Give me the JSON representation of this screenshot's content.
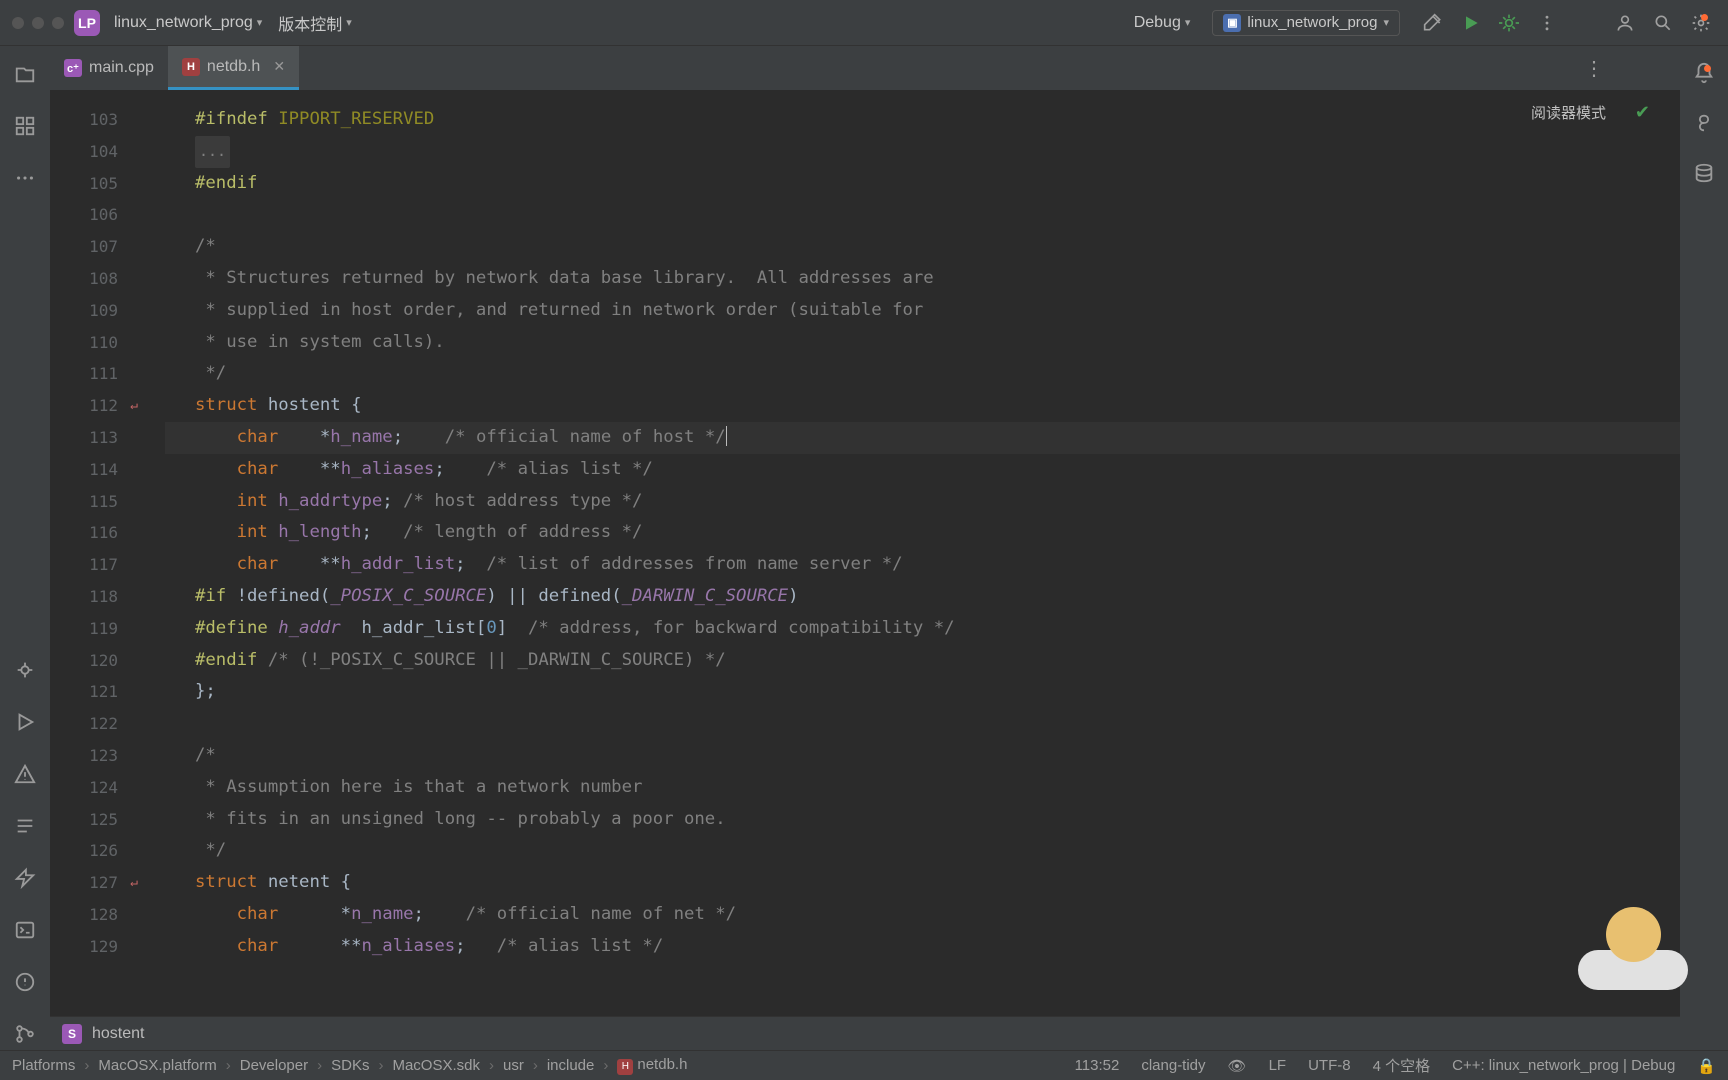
{
  "topbar": {
    "project_badge": "LP",
    "project_name": "linux_network_prog",
    "vcs_label": "版本控制",
    "build_config": "Debug",
    "run_config_name": "linux_network_prog"
  },
  "tabs": {
    "items": [
      {
        "icon_class": "ico-cpp",
        "icon_text": "c⁺",
        "label": "main.cpp",
        "closable": false,
        "active": false
      },
      {
        "icon_class": "ico-h",
        "icon_text": "H",
        "label": "netdb.h",
        "closable": true,
        "active": true
      }
    ],
    "reader_mode_label": "阅读器模式"
  },
  "struct_bar": {
    "icon_letter": "S",
    "name": "hostent"
  },
  "status": {
    "crumbs": [
      "Platforms",
      "MacOSX.platform",
      "Developer",
      "SDKs",
      "MacOSX.sdk",
      "usr",
      "include",
      "netdb.h"
    ],
    "pos": "113:52",
    "linter": "clang-tidy",
    "lf": "LF",
    "encoding": "UTF-8",
    "indent": "4 个空格",
    "context": "C++: linux_network_prog | Debug"
  },
  "gutter": {
    "start": 103,
    "count": 27,
    "arrow_rows": [
      112,
      127
    ]
  },
  "code": [
    {
      "n": 103,
      "tokens": [
        [
          "pp",
          "#ifndef "
        ],
        [
          "mac",
          "IPPORT_RESERVED"
        ]
      ]
    },
    {
      "n": 104,
      "fold": "..."
    },
    {
      "n": 105,
      "tokens": [
        [
          "pp",
          "#endif"
        ]
      ]
    },
    {
      "n": 106,
      "tokens": []
    },
    {
      "n": 107,
      "tokens": [
        [
          "cmt",
          "/*"
        ]
      ]
    },
    {
      "n": 108,
      "tokens": [
        [
          "cmt",
          " * Structures returned by network data base library.  All addresses are"
        ]
      ]
    },
    {
      "n": 109,
      "tokens": [
        [
          "cmt",
          " * supplied in host order, and returned in network order (suitable for"
        ]
      ]
    },
    {
      "n": 110,
      "tokens": [
        [
          "cmt",
          " * use in system calls)."
        ]
      ]
    },
    {
      "n": 111,
      "tokens": [
        [
          "cmt",
          " */"
        ]
      ]
    },
    {
      "n": 112,
      "tokens": [
        [
          "kw",
          "struct "
        ],
        [
          "txt",
          "hostent {"
        ]
      ]
    },
    {
      "n": 113,
      "hl": true,
      "cursor": true,
      "tokens": [
        [
          "txt",
          "    "
        ],
        [
          "kw",
          "char"
        ],
        [
          "txt",
          "    *"
        ],
        [
          "id",
          "h_name"
        ],
        [
          "txt",
          ";    "
        ],
        [
          "cmt",
          "/* official name of host */"
        ]
      ]
    },
    {
      "n": 114,
      "tokens": [
        [
          "txt",
          "    "
        ],
        [
          "kw",
          "char"
        ],
        [
          "txt",
          "    **"
        ],
        [
          "id",
          "h_aliases"
        ],
        [
          "txt",
          ";    "
        ],
        [
          "cmt",
          "/* alias list */"
        ]
      ]
    },
    {
      "n": 115,
      "tokens": [
        [
          "txt",
          "    "
        ],
        [
          "kw",
          "int "
        ],
        [
          "id",
          "h_addrtype"
        ],
        [
          "txt",
          "; "
        ],
        [
          "cmt",
          "/* host address type */"
        ]
      ]
    },
    {
      "n": 116,
      "tokens": [
        [
          "txt",
          "    "
        ],
        [
          "kw",
          "int "
        ],
        [
          "id",
          "h_length"
        ],
        [
          "txt",
          ";   "
        ],
        [
          "cmt",
          "/* length of address */"
        ]
      ]
    },
    {
      "n": 117,
      "tokens": [
        [
          "txt",
          "    "
        ],
        [
          "kw",
          "char"
        ],
        [
          "txt",
          "    **"
        ],
        [
          "id",
          "h_addr_list"
        ],
        [
          "txt",
          ";  "
        ],
        [
          "cmt",
          "/* list of addresses from name server */"
        ]
      ]
    },
    {
      "n": 118,
      "tokens": [
        [
          "pp",
          "#if "
        ],
        [
          "txt",
          "!defined("
        ],
        [
          "mac2",
          "_POSIX_C_SOURCE"
        ],
        [
          "txt",
          ") || defined("
        ],
        [
          "mac2",
          "_DARWIN_C_SOURCE"
        ],
        [
          "txt",
          ")"
        ]
      ]
    },
    {
      "n": 119,
      "tokens": [
        [
          "pp",
          "#define "
        ],
        [
          "mac2",
          "h_addr"
        ],
        [
          "txt",
          "  h_addr_list["
        ],
        [
          "num",
          "0"
        ],
        [
          "txt",
          "]  "
        ],
        [
          "cmt",
          "/* address, for backward compatibility */"
        ]
      ]
    },
    {
      "n": 120,
      "tokens": [
        [
          "pp",
          "#endif "
        ],
        [
          "cmt",
          "/* (!_POSIX_C_SOURCE || _DARWIN_C_SOURCE) */"
        ]
      ]
    },
    {
      "n": 121,
      "tokens": [
        [
          "txt",
          "};"
        ]
      ]
    },
    {
      "n": 122,
      "tokens": []
    },
    {
      "n": 123,
      "tokens": [
        [
          "cmt",
          "/*"
        ]
      ]
    },
    {
      "n": 124,
      "tokens": [
        [
          "cmt",
          " * Assumption here is that a network number"
        ]
      ]
    },
    {
      "n": 125,
      "tokens": [
        [
          "cmt",
          " * fits in an unsigned long -- probably a poor one."
        ]
      ]
    },
    {
      "n": 126,
      "tokens": [
        [
          "cmt",
          " */"
        ]
      ]
    },
    {
      "n": 127,
      "tokens": [
        [
          "kw",
          "struct "
        ],
        [
          "txt",
          "netent {"
        ]
      ]
    },
    {
      "n": 128,
      "tokens": [
        [
          "txt",
          "    "
        ],
        [
          "kw",
          "char"
        ],
        [
          "txt",
          "      *"
        ],
        [
          "id",
          "n_name"
        ],
        [
          "txt",
          ";    "
        ],
        [
          "cmt",
          "/* official name of net */"
        ]
      ]
    },
    {
      "n": 129,
      "tokens": [
        [
          "txt",
          "    "
        ],
        [
          "kw",
          "char"
        ],
        [
          "txt",
          "      **"
        ],
        [
          "id",
          "n_aliases"
        ],
        [
          "txt",
          ";   "
        ],
        [
          "cmt",
          "/* alias list */"
        ]
      ]
    }
  ]
}
